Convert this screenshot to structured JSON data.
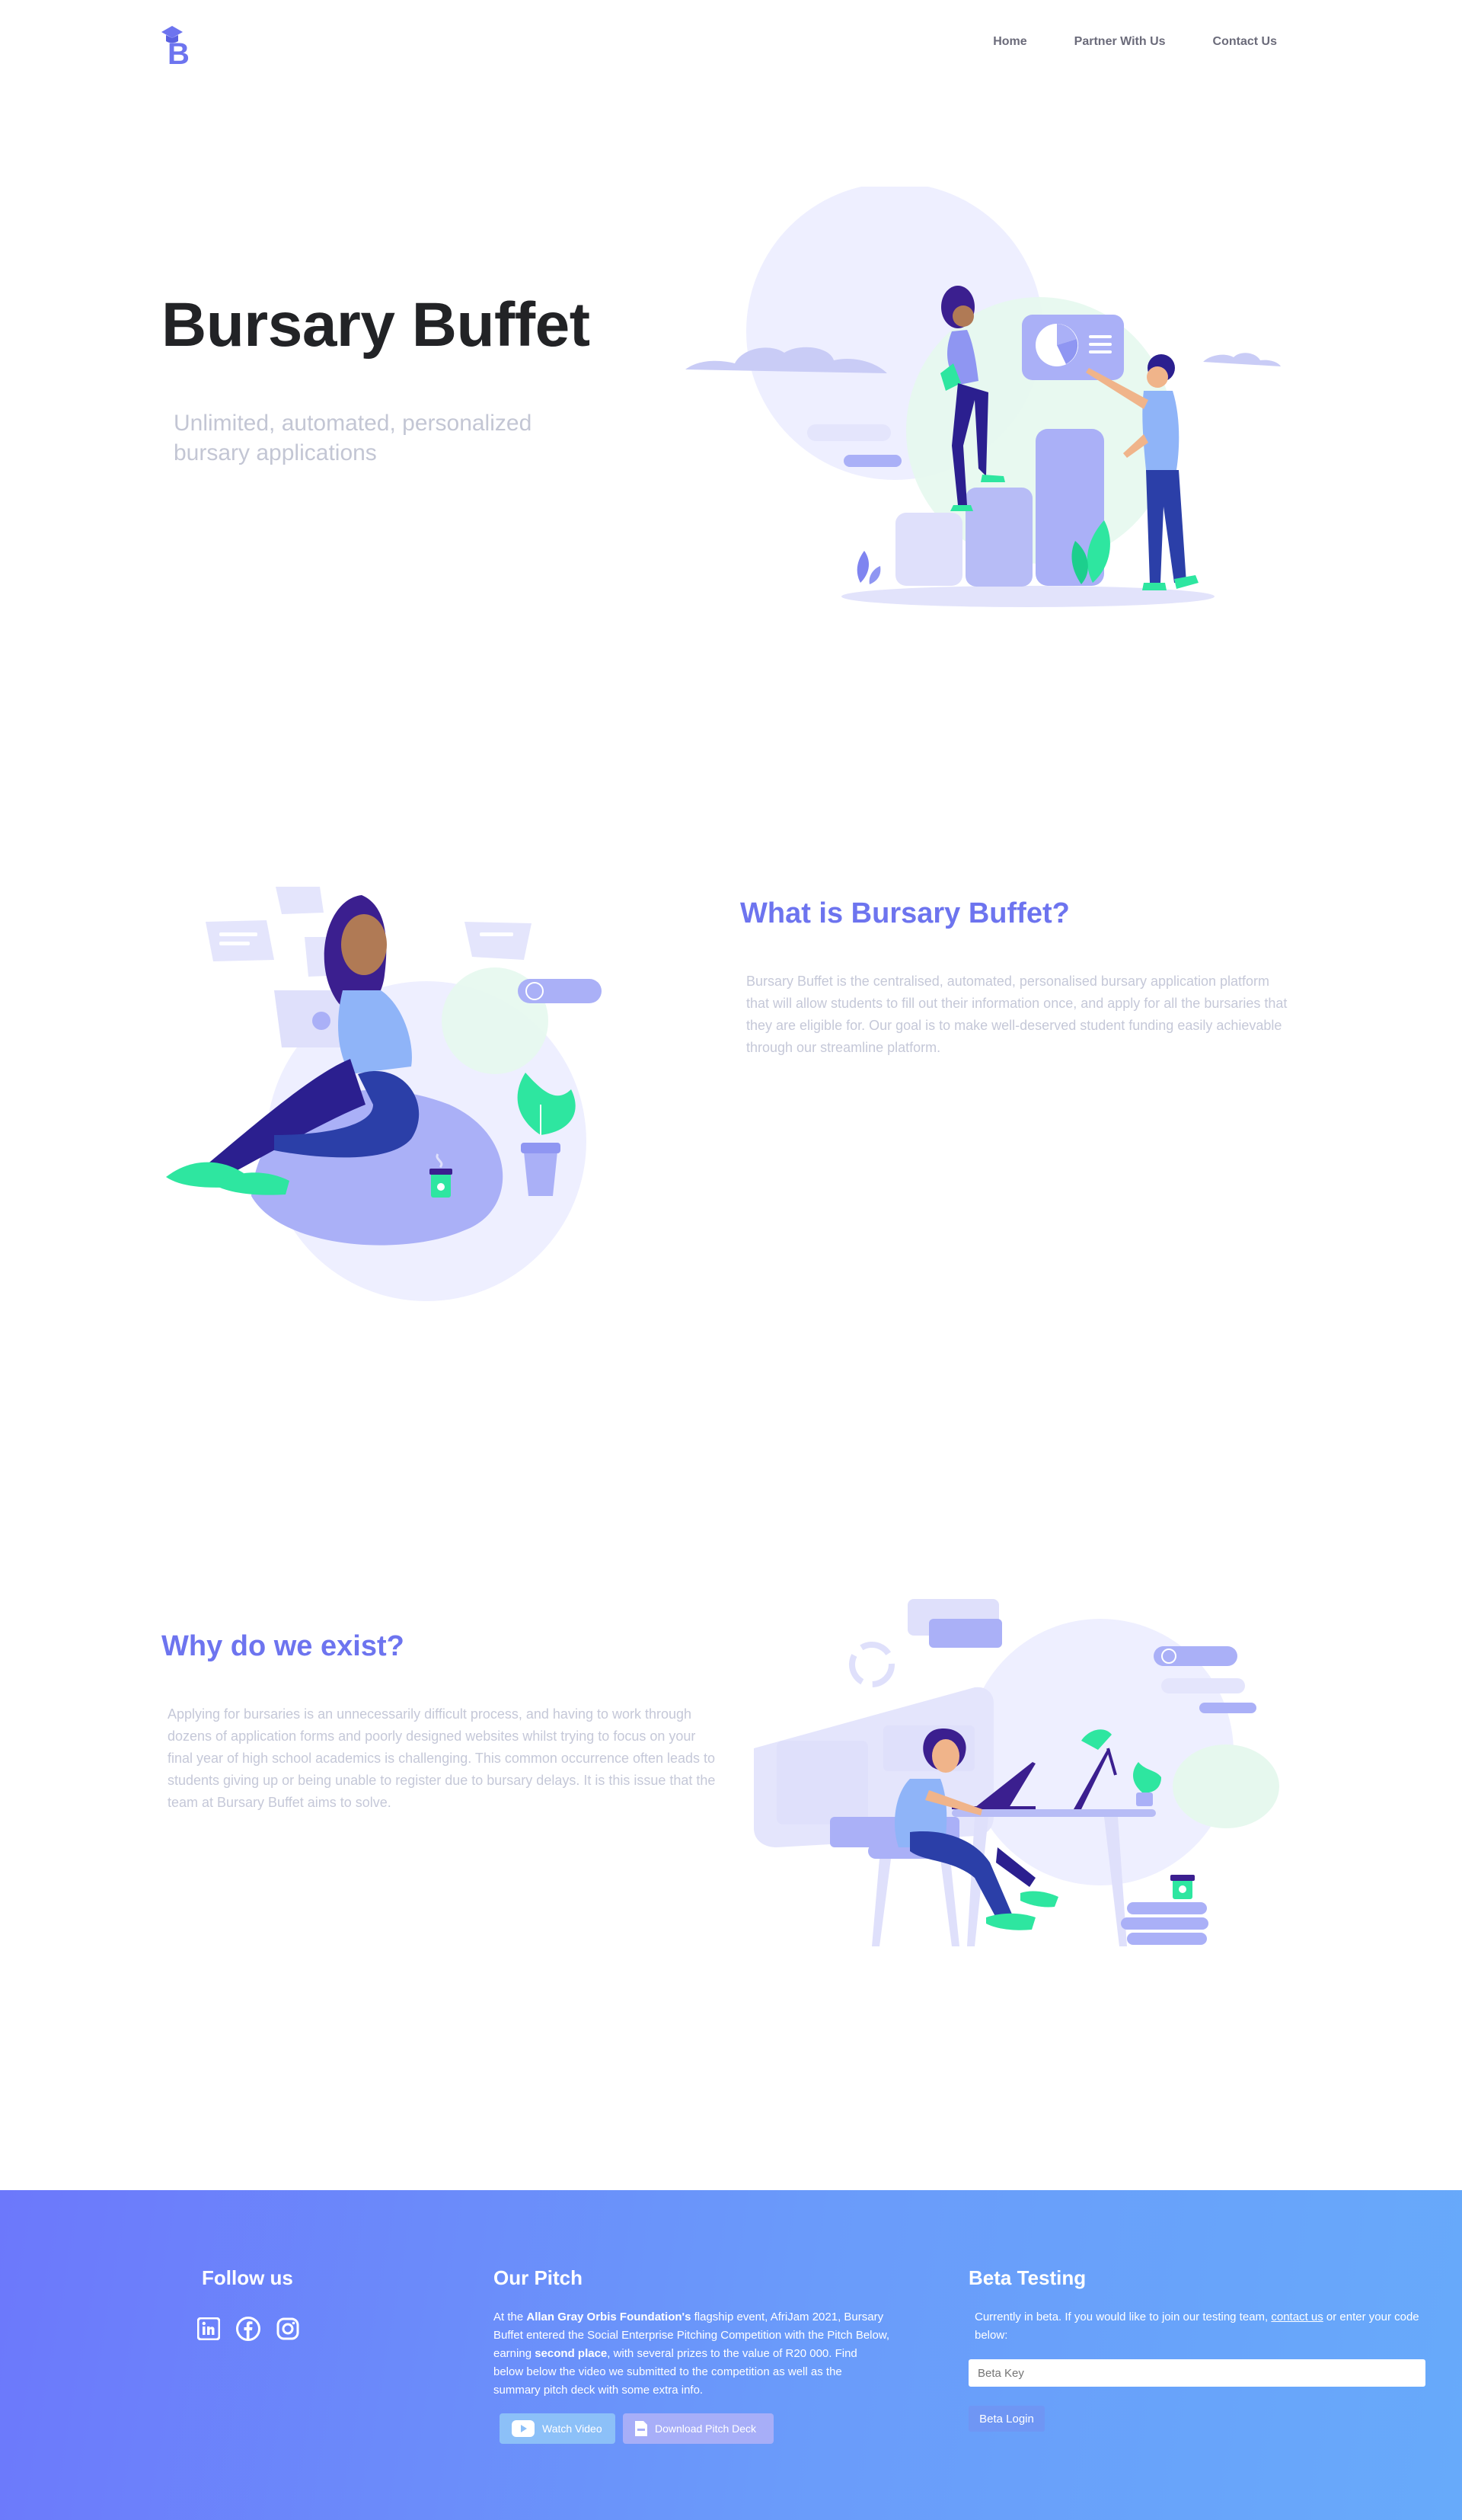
{
  "nav": {
    "logo_letter": "B",
    "links": [
      "Home",
      "Partner With Us",
      "Contact Us"
    ]
  },
  "hero": {
    "title": "Bursary Buffet",
    "subtitle": "Unlimited, automated, personalized bursary applications"
  },
  "about": {
    "title": "What is Bursary Buffet?",
    "text": "Bursary Buffet is the centralised, automated, personalised bursary application platform that will allow students to fill out their information once, and apply for all the bursaries that they are eligible for. Our goal is to make well-deserved student funding easily achievable through our streamline platform."
  },
  "why": {
    "title": "Why do we exist?",
    "text": "Applying for bursaries is an unnecessarily difficult process, and having to work through dozens of application forms and poorly designed websites whilst trying to focus on your final year of high school academics is challenging. This common occurrence often leads to students giving up or being unable to register due to bursary delays. It is this issue that the team at Bursary Buffet aims to solve."
  },
  "footer": {
    "follow": {
      "heading": "Follow us",
      "icons": [
        "linkedin-icon",
        "facebook-icon",
        "instagram-icon"
      ]
    },
    "pitch": {
      "heading": "Our Pitch",
      "t1": "At the ",
      "b1": "Allan Gray Orbis Foundation's",
      "t2": " flagship event, AfriJam 2021, Bursary Buffet entered the Social Enterprise Pitching Competition with the Pitch Below, earning ",
      "b2": "second place",
      "t3": ", with several prizes to the value of R20 000. Find below below the video we submitted to the competition as well as the summary pitch deck with some extra info.",
      "video_label": "Watch Video",
      "deck_label": "Download Pitch Deck"
    },
    "beta": {
      "heading": "Beta Testing",
      "t1": "Currently in beta. If you would like to join our testing team, ",
      "link": "contact us",
      "t2": " or enter your code below:",
      "placeholder": "Beta Key",
      "button": "Beta Login"
    }
  },
  "colors": {
    "accent": "#6d74ef",
    "green": "#2ee6a0",
    "navy": "#2b1f8f",
    "lavender": "#aab0f7"
  }
}
